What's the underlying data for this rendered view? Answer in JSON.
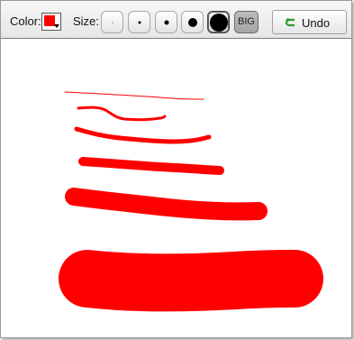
{
  "toolbar": {
    "color_label": "Color:",
    "color_value": "#ff0000",
    "size_label": "Size:",
    "sizes": [
      {
        "name": "size-xsmall"
      },
      {
        "name": "size-small"
      },
      {
        "name": "size-medium"
      },
      {
        "name": "size-large"
      },
      {
        "name": "size-xlarge",
        "selected": true
      }
    ],
    "big_label": "BIG",
    "undo_label": "Undo"
  },
  "canvas": {
    "stroke_color": "#ff0000",
    "strokes": 6
  },
  "colors": {
    "undo_icon": "#2e9a2e"
  }
}
